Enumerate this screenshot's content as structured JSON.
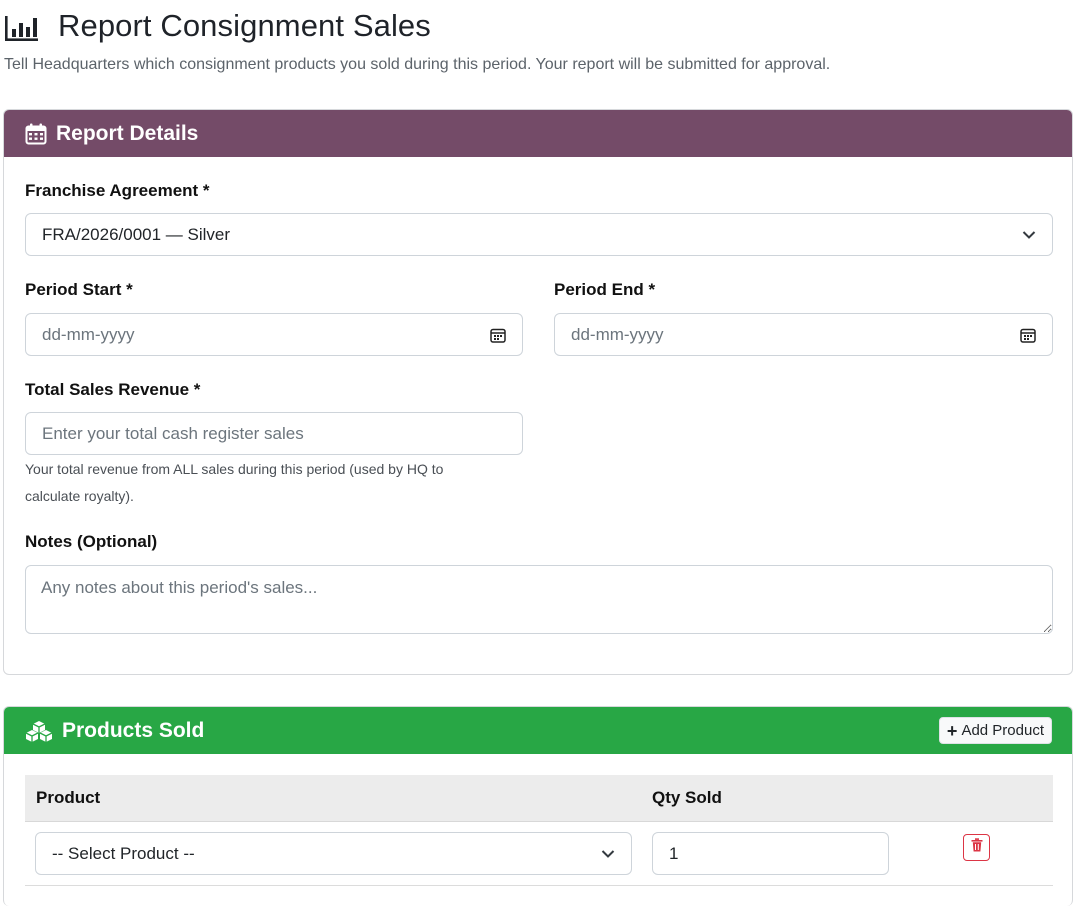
{
  "header": {
    "title": "Report Consignment Sales",
    "subtitle": "Tell Headquarters which consignment products you sold during this period. Your report will be submitted for approval.",
    "icon": "bar-chart-icon"
  },
  "report_details": {
    "title": "Report Details",
    "icon": "calendar-icon",
    "header_color": "#744b68",
    "franchise_agreement": {
      "label": "Franchise Agreement *",
      "value": "FRA/2026/0001 — Silver"
    },
    "period_start": {
      "label": "Period Start *",
      "placeholder": "dd-mm-yyyy"
    },
    "period_end": {
      "label": "Period End *",
      "placeholder": "dd-mm-yyyy"
    },
    "total_sales_revenue": {
      "label": "Total Sales Revenue *",
      "placeholder": "Enter your total cash register sales",
      "help_line1": "Your total revenue from ALL sales during this period (used by HQ to",
      "help_line2": "calculate royalty)."
    },
    "notes": {
      "label": "Notes (Optional)",
      "placeholder": "Any notes about this period's sales..."
    }
  },
  "products_sold": {
    "title": "Products Sold",
    "icon": "boxes-icon",
    "header_color": "#28a745",
    "add_button_label": "Add Product",
    "columns": {
      "product": "Product",
      "qty": "Qty Sold"
    },
    "rows": [
      {
        "product": "-- Select Product --",
        "qty": "1"
      }
    ]
  }
}
